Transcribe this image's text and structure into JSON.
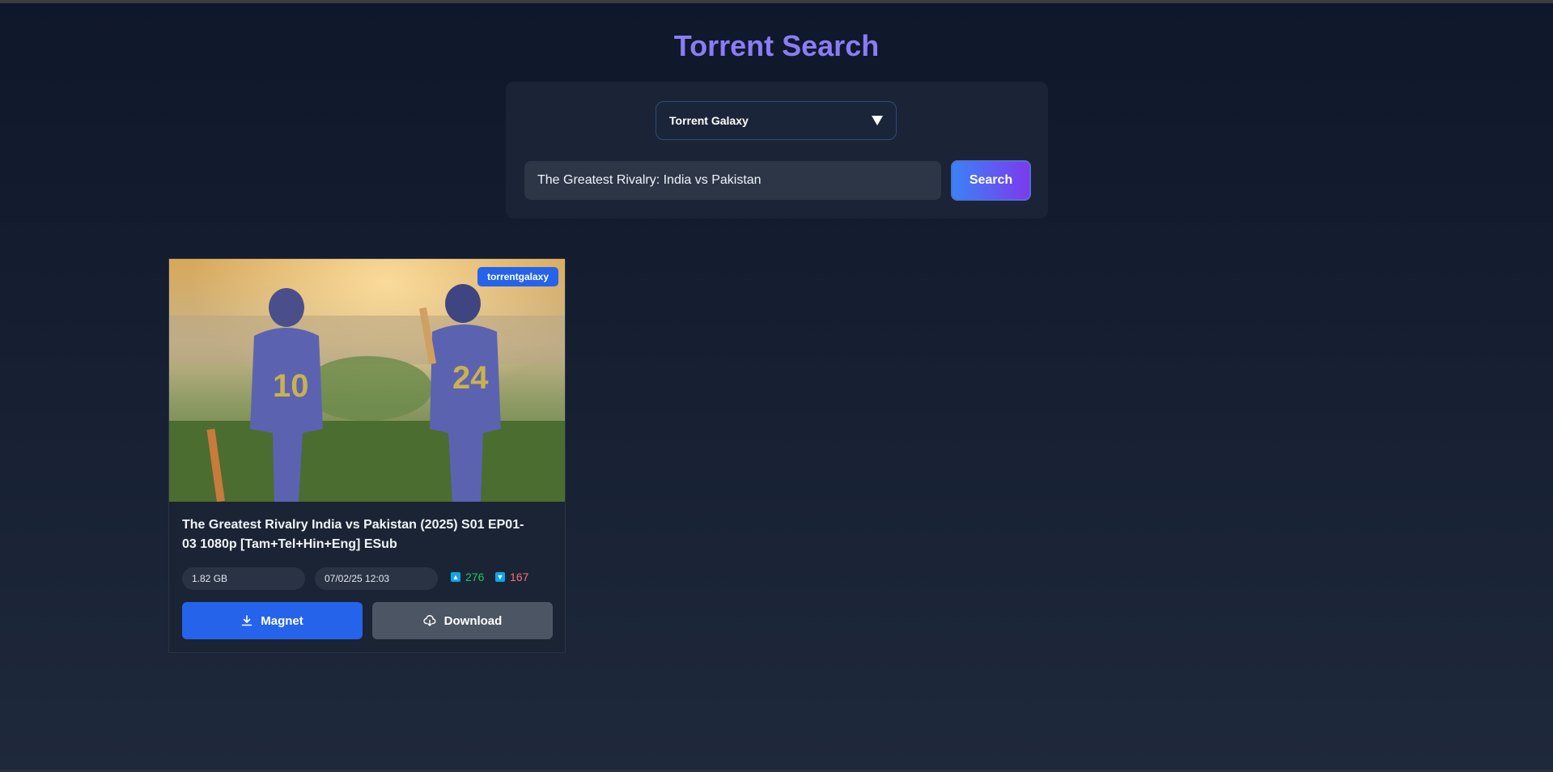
{
  "app": {
    "title": "Torrent Search"
  },
  "search": {
    "provider_selected": "Torrent Galaxy",
    "query": "The Greatest Rivalry: India vs Pakistan",
    "button_label": "Search"
  },
  "results": [
    {
      "source_badge": "torrentgalaxy",
      "title": "The Greatest Rivalry India vs Pakistan (2025) S01 EP01-03 1080p [Tam+Tel+Hin+Eng] ESub",
      "size": "1.82 GB",
      "date": "07/02/25 12:03",
      "seeders": "276",
      "leechers": "167",
      "magnet_label": "Magnet",
      "download_label": "Download"
    }
  ],
  "colors": {
    "accent": "#8b7cf6",
    "primary_button": "#2563eb",
    "seeders": "#22c55e",
    "leechers": "#f87171"
  },
  "icons": {
    "select": "chevron-down-icon",
    "seeders": "arrow-up-icon",
    "leechers": "arrow-down-icon",
    "magnet": "download-icon",
    "download": "cloud-download-icon"
  }
}
